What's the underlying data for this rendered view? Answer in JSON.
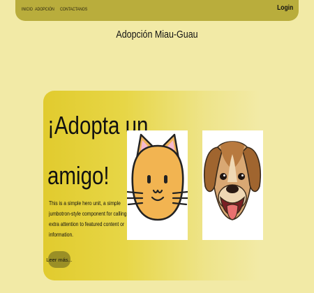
{
  "nav": {
    "links": [
      "INICIO",
      "ADOPCIÓN",
      "CONTACTANOS"
    ],
    "login": "Login"
  },
  "page": {
    "title": "Adopción Miau-Guau"
  },
  "hero": {
    "title_line1": "¡Adopta un",
    "title_line2": "amigo!",
    "text_lines": [
      "This is a simple hero unit, a simple",
      "jumbotron-style component for calling",
      "extra attention to featured content or",
      "information."
    ],
    "button": "Leer más..."
  },
  "colors": {
    "background": "#f2eaa6",
    "navbar": "#b9ad3c",
    "hero_gradient_start": "#e1cb2e",
    "button": "#9a8f26"
  },
  "images": [
    "cat-face",
    "dog-face"
  ]
}
